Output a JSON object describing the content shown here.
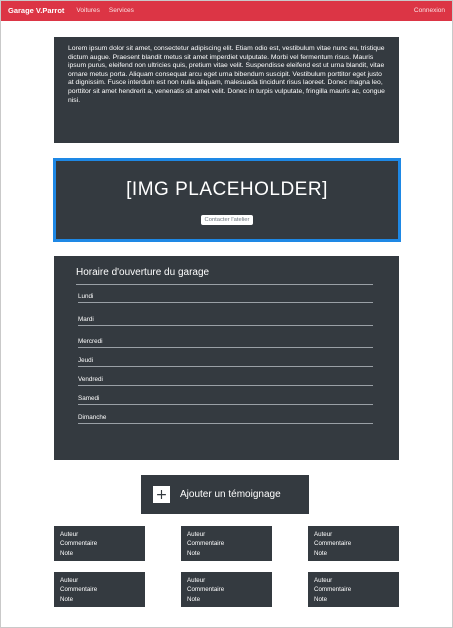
{
  "navbar": {
    "brand": "Garage V.Parrot",
    "links": [
      "Voitures",
      "Services"
    ],
    "login": "Connexion"
  },
  "intro": {
    "text": "Lorem ipsum dolor sit amet, consectetur adipiscing elit. Etiam odio est, vestibulum vitae nunc eu, tristique dictum augue. Praesent blandit metus sit amet imperdiet vulputate. Morbi vel fermentum risus. Mauris ipsum purus, eleifend non ultricies quis, pretium vitae velit. Suspendisse eleifend est ut urna blandit, vitae ornare metus porta. Aliquam consequat arcu eget urna bibendum suscipit. Vestibulum porttitor eget justo at dignissim. Fusce interdum est non nulla aliquam, malesuada tincidunt risus laoreet. Donec magna leo, porttitor sit amet hendrerit a, venenatis sit amet velit. Donec in turpis vulputate, fringilla mauris ac, congue nisi."
  },
  "hero": {
    "title": "[IMG PLACEHOLDER]",
    "button": "Contacter l'atelier"
  },
  "hours": {
    "title": "Horaire d'ouverture du garage",
    "days": [
      "Lundi",
      "Mardi",
      "Mercredi",
      "Jeudi",
      "Vendredi",
      "Samedi",
      "Dimanche"
    ]
  },
  "add_testimonial": {
    "icon": "plus-icon",
    "glyph": "+",
    "label": "Ajouter un témoignage"
  },
  "testimonials": [
    {
      "author": "Auteur",
      "comment": "Commentaire",
      "rating": "Note"
    },
    {
      "author": "Auteur",
      "comment": "Commentaire",
      "rating": "Note"
    },
    {
      "author": "Auteur",
      "comment": "Commentaire",
      "rating": "Note"
    },
    {
      "author": "Auteur",
      "comment": "Commentaire",
      "rating": "Note"
    },
    {
      "author": "Auteur",
      "comment": "Commentaire",
      "rating": "Note"
    },
    {
      "author": "Auteur",
      "comment": "Commentaire",
      "rating": "Note"
    }
  ],
  "colors": {
    "navbar": "#dc3545",
    "card": "#343a40",
    "hero_border": "#1e88e5"
  }
}
